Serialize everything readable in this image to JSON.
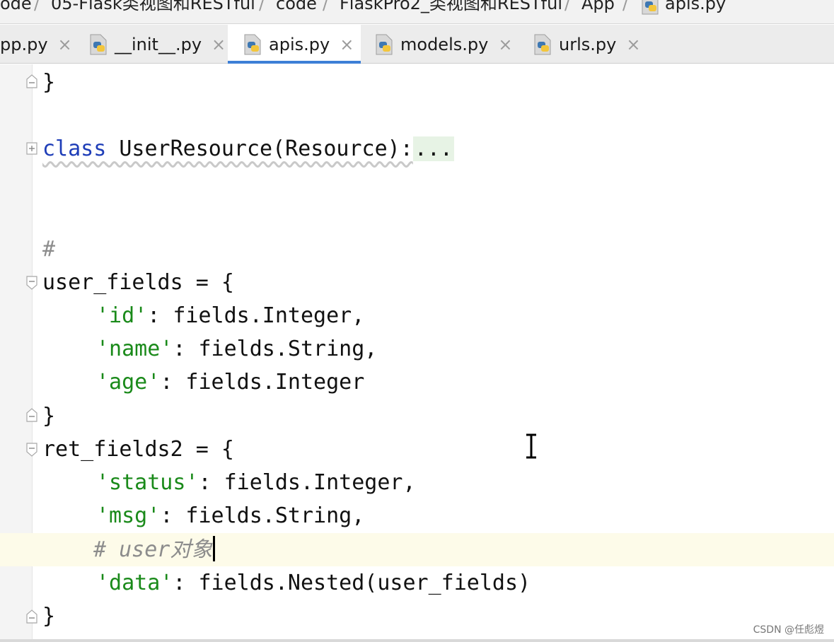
{
  "breadcrumb": [
    "ode",
    "05-Flask类视图和RESTful",
    "code",
    "FlaskPro2_类视图和RESTful",
    "App",
    "apis.py"
  ],
  "tabs": [
    {
      "label": "pp.py",
      "close": "×"
    },
    {
      "label": "__init__.py",
      "close": "×"
    },
    {
      "label": "apis.py",
      "close": "×",
      "active": true
    },
    {
      "label": "models.py",
      "close": "×"
    },
    {
      "label": "urls.py",
      "close": "×"
    }
  ],
  "code": {
    "l1": "}",
    "l2_kw": "class",
    "l2_name": " UserResource(Resource):",
    "l2_dots": "...",
    "l3": "#",
    "l4": "user_fields = {",
    "l5_key": "'id'",
    "l5_val": ": fields.Integer,",
    "l6_key": "'name'",
    "l6_val": ": fields.String,",
    "l7_key": "'age'",
    "l7_val": ": fields.Integer",
    "l8": "}",
    "l9": "ret_fields2 = {",
    "l10_key": "'status'",
    "l10_val": ": fields.Integer,",
    "l11_key": "'msg'",
    "l11_val": ": fields.String,",
    "l12_comment": "# user对象",
    "l13_key": "'data'",
    "l13_val": ": fields.Nested(user_fields)",
    "l14": "}"
  },
  "colors": {
    "keyword": "#1f3eb8",
    "string": "#1a8a1a",
    "comment": "#8c8c8c",
    "active_tab_underline": "#3d7fd6"
  },
  "icons": {
    "tab_file": "python-file-icon",
    "fold": "fold-marker-icon",
    "cursor": "text-cursor-icon"
  },
  "watermark": "CSDN @任彪煜"
}
